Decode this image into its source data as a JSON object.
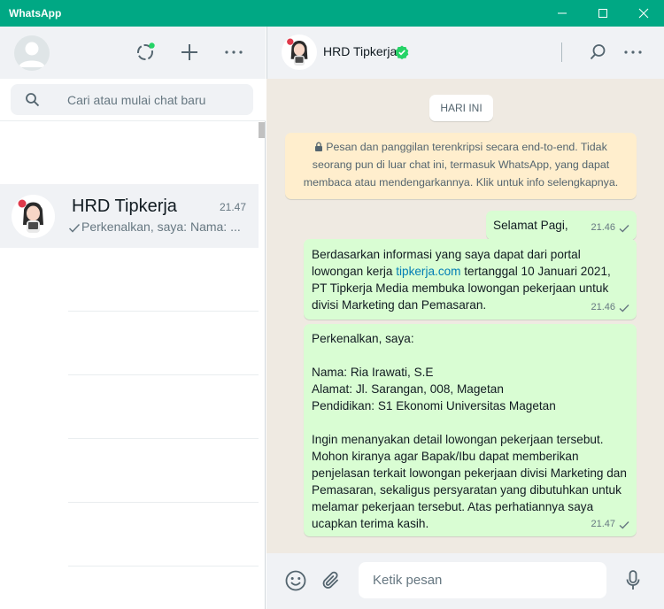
{
  "window": {
    "title": "WhatsApp",
    "controls": [
      "minimize-icon",
      "maximize-icon",
      "close-icon"
    ],
    "accent_color": "#00a884"
  },
  "sidebar": {
    "header_icons": [
      "status-icon",
      "new-chat-icon",
      "menu-icon"
    ],
    "search": {
      "placeholder": "Cari atau mulai chat baru"
    },
    "chats": [
      {
        "name": "HRD Tipkerja",
        "time": "21.47",
        "preview": "Perkenalkan, saya:  Nama: ...",
        "status": "sent"
      }
    ]
  },
  "conversation": {
    "contact_name": "HRD Tipkerja",
    "verified": true,
    "header_icons": [
      "search-icon",
      "menu-icon"
    ],
    "day_label": "HARI INI",
    "encryption_notice": "Pesan dan panggilan terenkripsi secara end-to-end. Tidak seorang pun di luar chat ini, termasuk WhatsApp, yang dapat membaca atau mendengarkannya. Klik untuk info selengkapnya.",
    "messages": [
      {
        "text": "Selamat Pagi,",
        "time": "21.46",
        "status": "sent"
      },
      {
        "text_before_link": "Berdasarkan informasi yang saya dapat dari portal lowongan kerja ",
        "link": "tipkerja.com",
        "text_after_link": " tertanggal 10 Januari 2021, PT Tipkerja Media membuka lowongan pekerjaan untuk divisi Marketing dan Pemasaran.",
        "time": "21.46",
        "status": "sent"
      },
      {
        "lines": [
          "Perkenalkan, saya:",
          "",
          "Nama: Ria Irawati, S.E",
          "Alamat: Jl. Sarangan, 008, Magetan",
          "Pendidikan: S1 Ekonomi Universitas Magetan",
          "",
          "Ingin menanyakan detail lowongan pekerjaan tersebut. Mohon kiranya agar Bapak/Ibu dapat memberikan penjelasan terkait lowongan pekerjaan divisi Marketing dan Pemasaran, sekaligus persyaratan yang dibutuhkan untuk melamar pekerjaan tersebut. Atas perhatiannya saya ucapkan terima kasih."
        ],
        "time": "21.47",
        "status": "sent"
      }
    ],
    "composer": {
      "placeholder": "Ketik pesan",
      "icons": [
        "emoji-icon",
        "attach-icon",
        "microphone-icon"
      ]
    }
  }
}
